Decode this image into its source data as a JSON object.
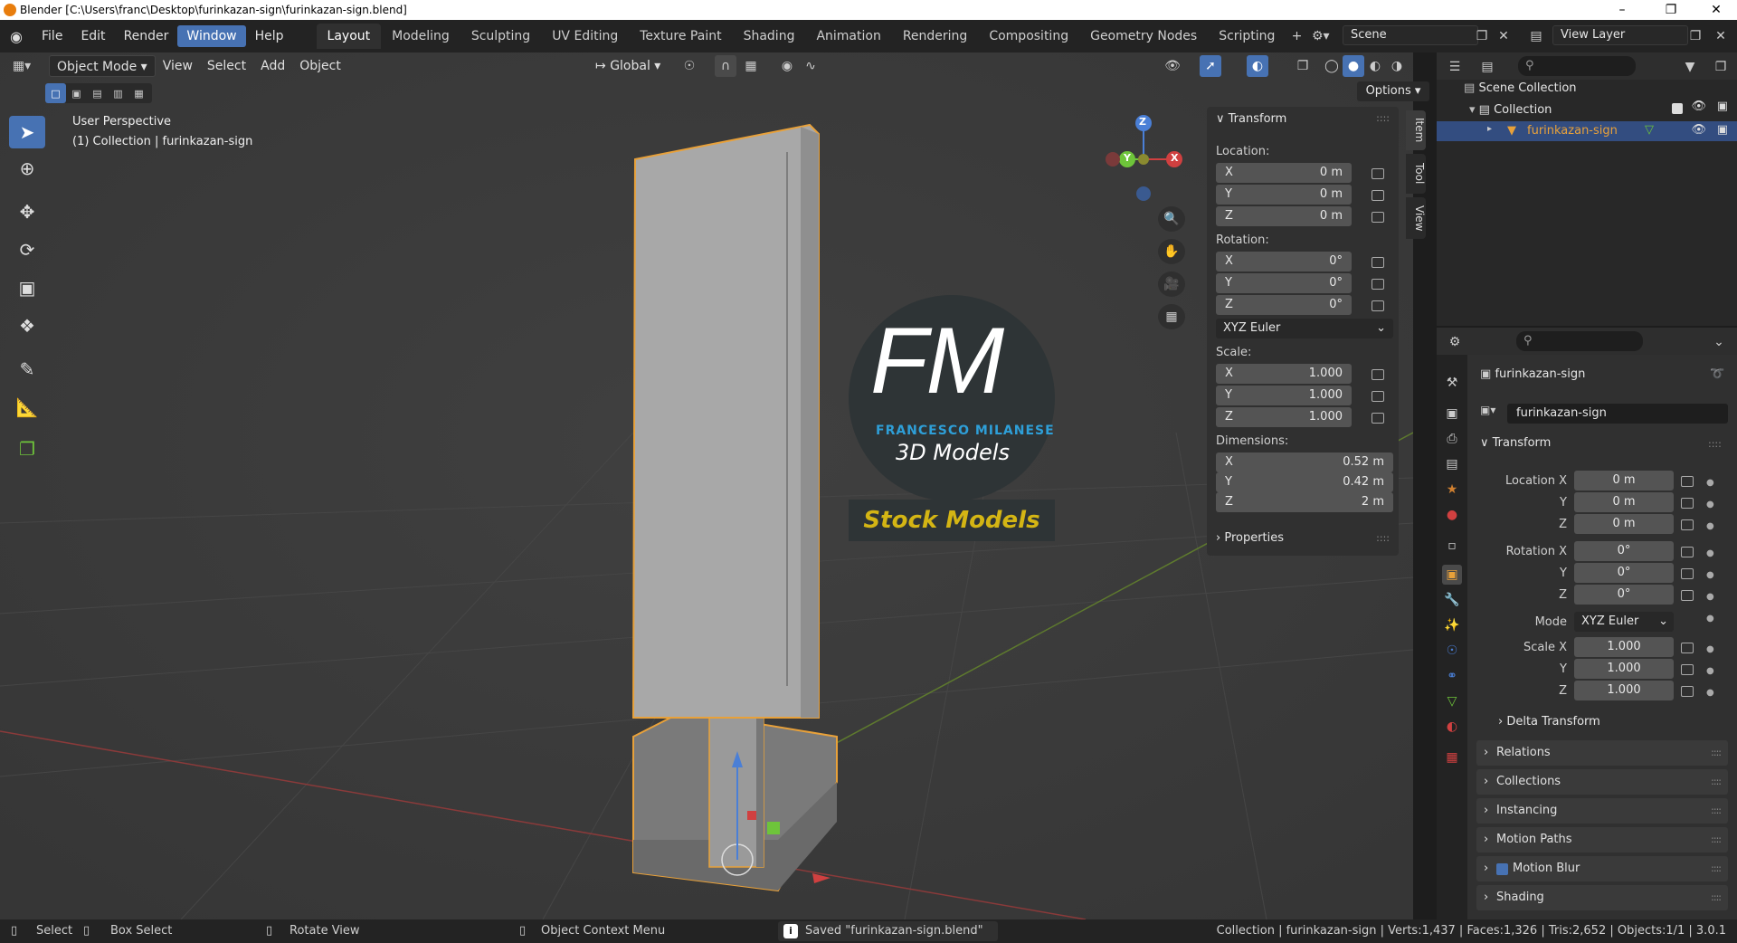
{
  "window": {
    "title": "Blender [C:\\Users\\franc\\Desktop\\furinkazan-sign\\furinkazan-sign.blend]"
  },
  "menu": [
    "File",
    "Edit",
    "Render",
    "Window",
    "Help"
  ],
  "workspaces": [
    "Layout",
    "Modeling",
    "Sculpting",
    "UV Editing",
    "Texture Paint",
    "Shading",
    "Animation",
    "Rendering",
    "Compositing",
    "Geometry Nodes",
    "Scripting"
  ],
  "scene": {
    "label": "Scene",
    "view_layer": "View Layer"
  },
  "viewport_header": {
    "mode": "Object Mode",
    "menus": [
      "View",
      "Select",
      "Add",
      "Object"
    ],
    "orientation": "Global",
    "options": "Options"
  },
  "viewport_overlay": {
    "perspective": "User Perspective",
    "collection": "(1) Collection | furinkazan-sign"
  },
  "gizmo": {
    "x": "X",
    "y": "Y",
    "z": "Z"
  },
  "watermark": {
    "logo": "FM",
    "name": "FRANCESCO MILANESE",
    "tagline": "3D Models",
    "badge": "Stock Models"
  },
  "npanel": {
    "section": "Transform",
    "location_label": "Location:",
    "location": [
      {
        "axis": "X",
        "value": "0 m"
      },
      {
        "axis": "Y",
        "value": "0 m"
      },
      {
        "axis": "Z",
        "value": "0 m"
      }
    ],
    "rotation_label": "Rotation:",
    "rotation": [
      {
        "axis": "X",
        "value": "0°"
      },
      {
        "axis": "Y",
        "value": "0°"
      },
      {
        "axis": "Z",
        "value": "0°"
      }
    ],
    "rotation_mode": "XYZ Euler",
    "scale_label": "Scale:",
    "scale": [
      {
        "axis": "X",
        "value": "1.000"
      },
      {
        "axis": "Y",
        "value": "1.000"
      },
      {
        "axis": "Z",
        "value": "1.000"
      }
    ],
    "dimensions_label": "Dimensions:",
    "dimensions": [
      {
        "axis": "X",
        "value": "0.52 m"
      },
      {
        "axis": "Y",
        "value": "0.42 m"
      },
      {
        "axis": "Z",
        "value": "2 m"
      }
    ],
    "properties": "Properties",
    "tabs": [
      "Item",
      "Tool",
      "View"
    ]
  },
  "outliner": {
    "root": "Scene Collection",
    "collection": "Collection",
    "object": "furinkazan-sign"
  },
  "properties": {
    "object_name": "furinkazan-sign",
    "data_name": "furinkazan-sign",
    "transform": "Transform",
    "location_x_label": "Location X",
    "rotation_x_label": "Rotation X",
    "scale_x_label": "Scale X",
    "y_label": "Y",
    "z_label": "Z",
    "location": [
      "0 m",
      "0 m",
      "0 m"
    ],
    "rotation": [
      "0°",
      "0°",
      "0°"
    ],
    "mode_label": "Mode",
    "mode": "XYZ Euler",
    "scale": [
      "1.000",
      "1.000",
      "1.000"
    ],
    "delta": "Delta Transform",
    "sections": [
      "Relations",
      "Collections",
      "Instancing",
      "Motion Paths",
      "Motion Blur",
      "Shading"
    ]
  },
  "statusbar": {
    "select": "Select",
    "box_select": "Box Select",
    "rotate_view": "Rotate View",
    "context_menu": "Object Context Menu",
    "saved": "Saved \"furinkazan-sign.blend\"",
    "stats": "Collection | furinkazan-sign | Verts:1,437 | Faces:1,326 | Tris:2,652 | Objects:1/1 | 3.0.1"
  },
  "colors": {
    "accent": "#4772b3",
    "selection": "#e8a13a",
    "badge_text": "#d4b514",
    "logo_blue": "#2e9fd8"
  }
}
